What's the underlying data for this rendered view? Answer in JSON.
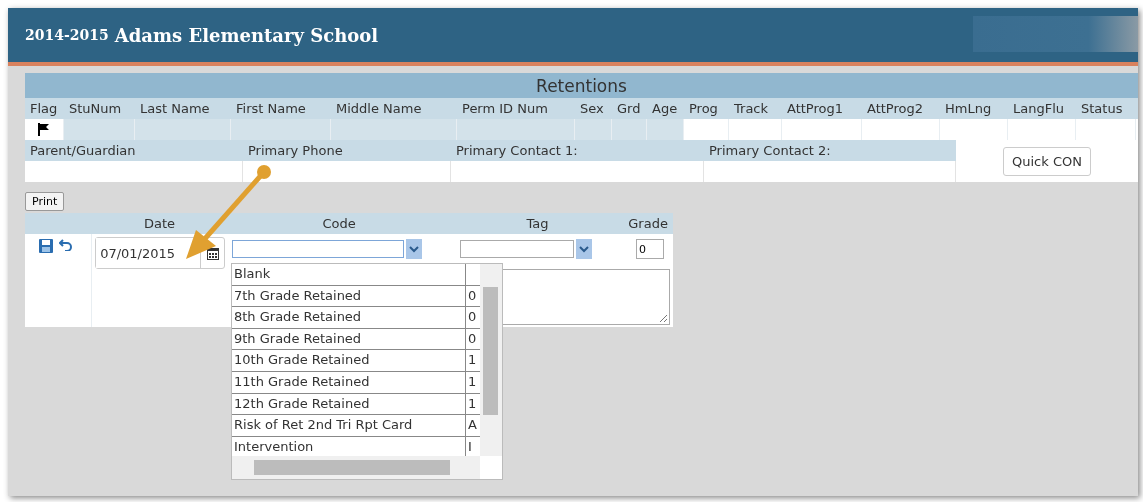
{
  "header": {
    "year": "2014-2015",
    "school": "Adams Elementary School"
  },
  "panel": {
    "title": "Retentions",
    "columns": [
      "Flag",
      "StuNum",
      "Last Name",
      "First Name",
      "Middle Name",
      "Perm ID Num",
      "Sex",
      "Grd",
      "Age",
      "Prog",
      "Track",
      "AttProg1",
      "AttProg2",
      "HmLng",
      "LangFlu",
      "Status"
    ],
    "contact_columns": [
      "Parent/Guardian",
      "Primary Phone",
      "Primary Contact 1:",
      "Primary Contact 2:"
    ],
    "quick_button": "Quick CON"
  },
  "print_button": "Print",
  "form": {
    "columns": [
      "Date",
      "Code",
      "Tag",
      "Grade"
    ],
    "date": "07/01/2015",
    "grade": "0"
  },
  "dropdown": {
    "items": [
      {
        "name": "Blank"
      },
      {
        "name": "7th Grade Retained",
        "code": "0"
      },
      {
        "name": "8th Grade Retained",
        "code": "0"
      },
      {
        "name": "9th Grade Retained",
        "code": "0"
      },
      {
        "name": "10th Grade Retained",
        "code": "1"
      },
      {
        "name": "11th Grade Retained",
        "code": "1"
      },
      {
        "name": "12th Grade Retained",
        "code": "1"
      },
      {
        "name": "Risk of Ret 2nd Tri Rpt Card",
        "code": "A"
      },
      {
        "name": "Intervention",
        "code": "I"
      }
    ]
  }
}
